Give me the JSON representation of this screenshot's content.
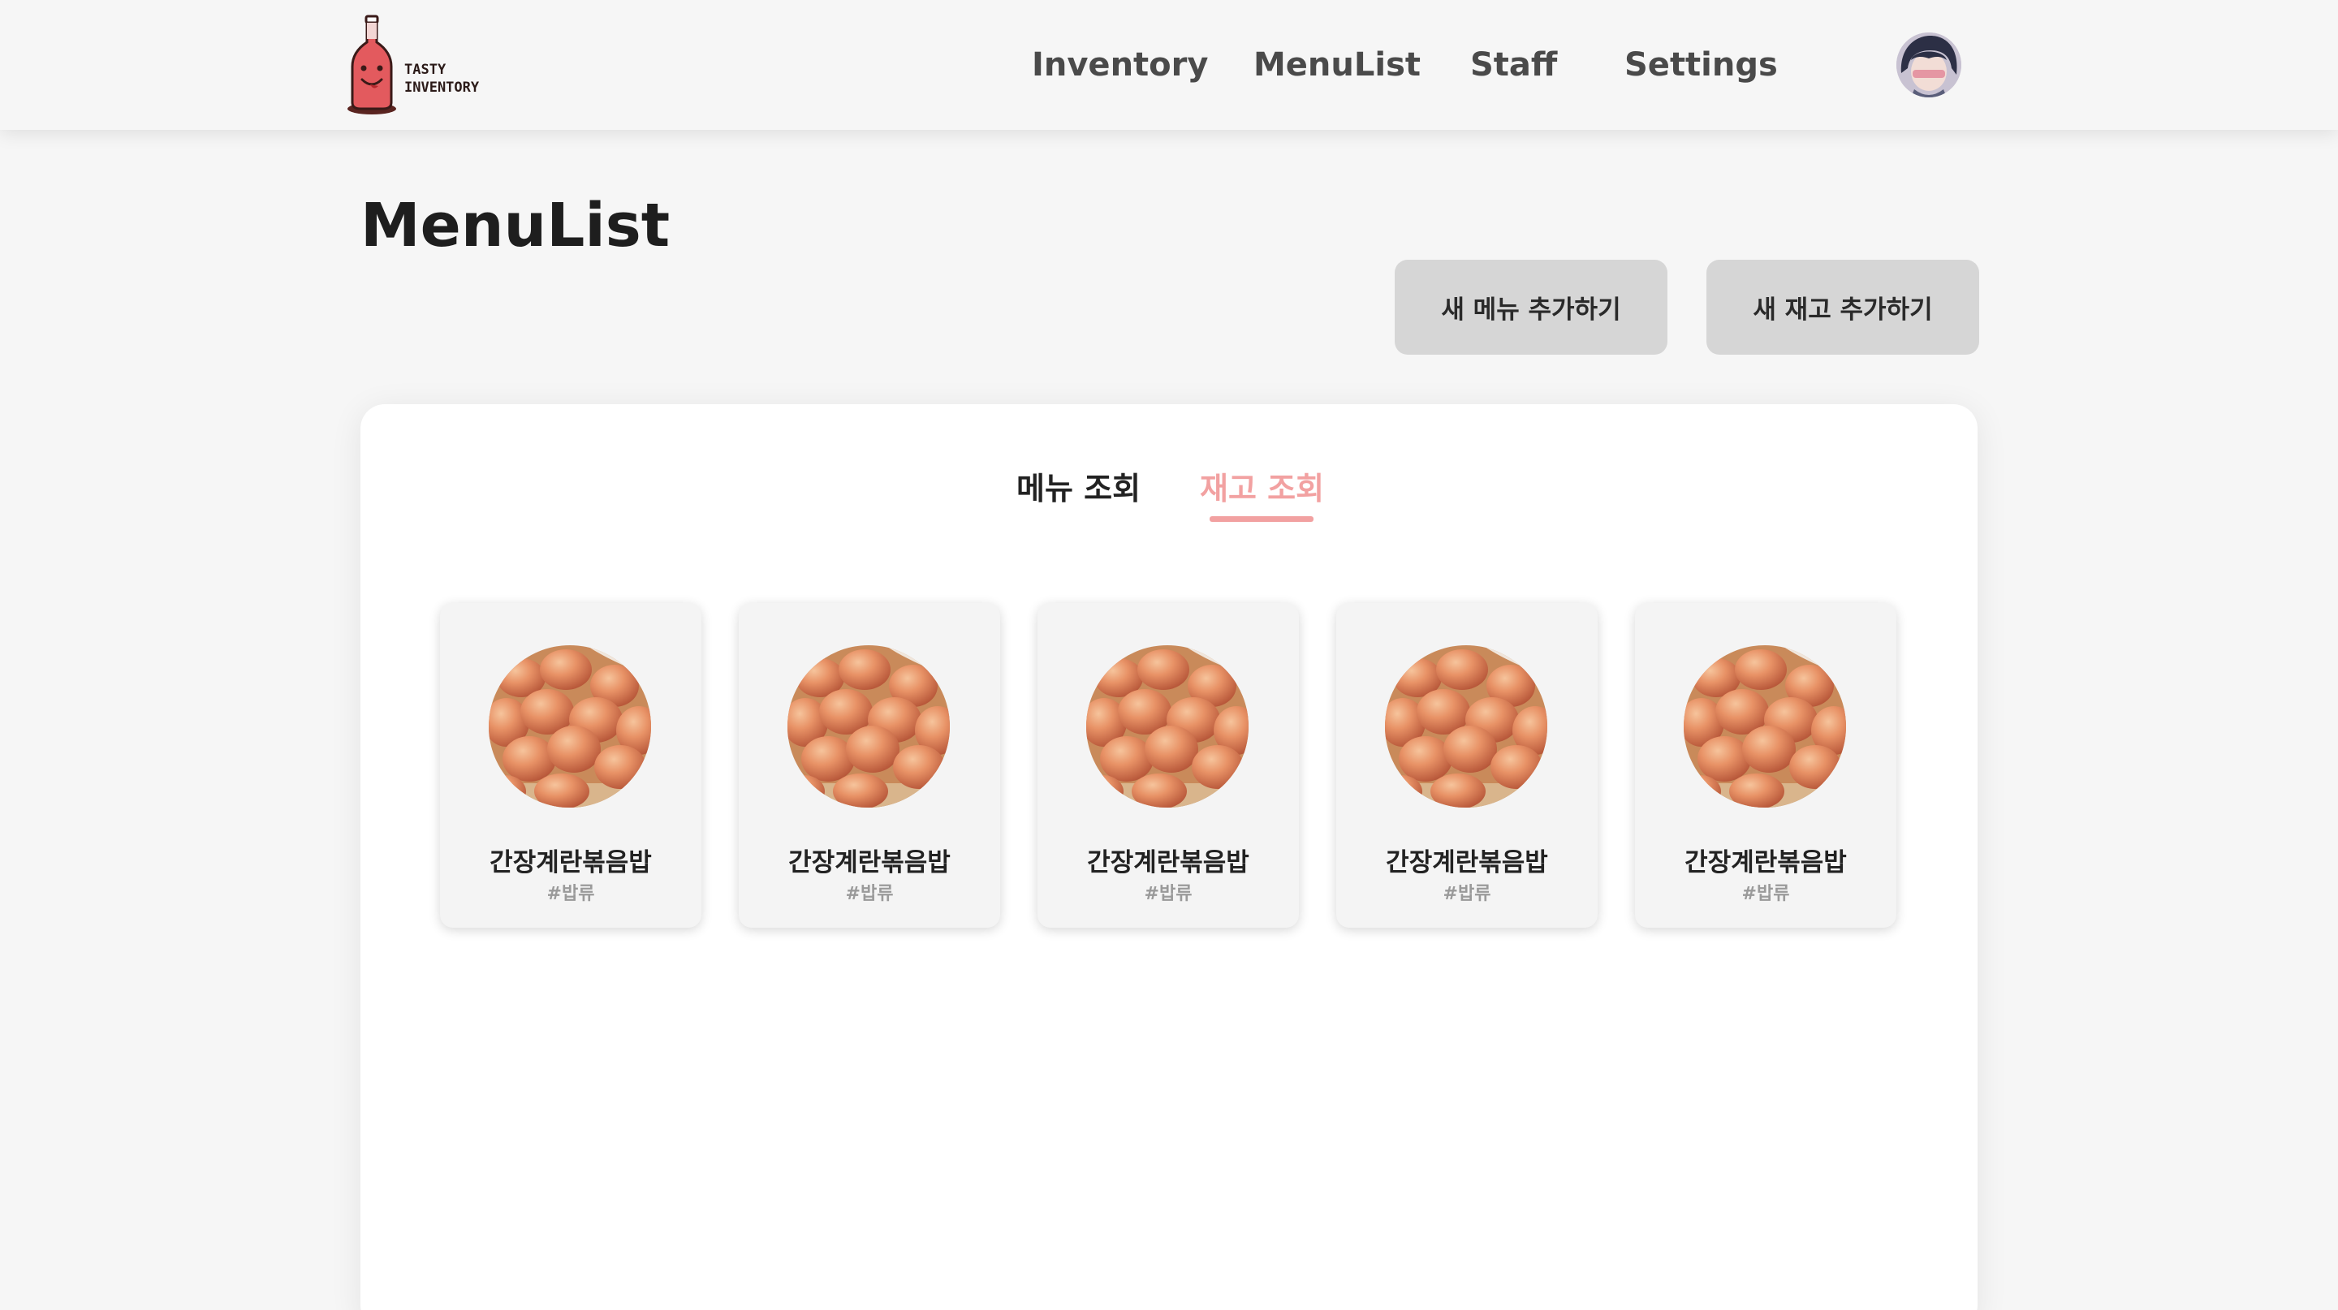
{
  "header": {
    "logo_lines": [
      "TASTY",
      "INVENTORY"
    ],
    "nav": [
      {
        "label": "Inventory"
      },
      {
        "label": "MenuList"
      },
      {
        "label": "Staff"
      },
      {
        "label": "Settings"
      }
    ],
    "avatar_icon": "user-avatar"
  },
  "page": {
    "title": "MenuList",
    "add_menu_button": "새 메뉴 추가하기",
    "add_stock_button": "새 재고 추가하기"
  },
  "tabs": {
    "menu": "메뉴 조회",
    "stock": "재고 조회",
    "active": "stock",
    "active_color": "#f2a1a1"
  },
  "cards": [
    {
      "name": "간장계란볶음밥",
      "tag": "#밥류",
      "image": "eggs-photo"
    },
    {
      "name": "간장계란볶음밥",
      "tag": "#밥류",
      "image": "eggs-photo"
    },
    {
      "name": "간장계란볶음밥",
      "tag": "#밥류",
      "image": "eggs-photo"
    },
    {
      "name": "간장계란볶음밥",
      "tag": "#밥류",
      "image": "eggs-photo"
    },
    {
      "name": "간장계란볶음밥",
      "tag": "#밥류",
      "image": "eggs-photo"
    }
  ]
}
